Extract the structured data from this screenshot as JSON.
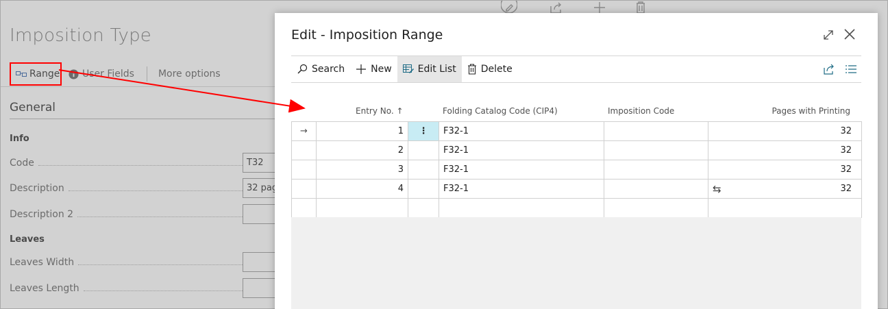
{
  "background": {
    "title": "Imposition Type",
    "actions": {
      "range": "Range",
      "user_fields": "User Fields",
      "more_options": "More options"
    },
    "section_general": "General",
    "group_info": "Info",
    "group_leaves": "Leaves",
    "fields": {
      "code": {
        "label": "Code",
        "value": "T32"
      },
      "description": {
        "label": "Description",
        "value": "32 pag"
      },
      "description2": {
        "label": "Description 2",
        "value": ""
      },
      "leaves_width": {
        "label": "Leaves Width",
        "value": ""
      },
      "leaves_length": {
        "label": "Leaves Length",
        "value": ""
      }
    }
  },
  "dialog": {
    "title": "Edit - Imposition Range",
    "toolbar": {
      "search": "Search",
      "new": "New",
      "edit_list": "Edit List",
      "delete": "Delete"
    },
    "columns": {
      "entry_no": "Entry No. ↑",
      "folding_catalog": "Folding Catalog Code (CIP4)",
      "imposition_code": "Imposition Code",
      "pages_printing": "Pages with Printing"
    },
    "rows": [
      {
        "entry": "1",
        "folding": "F32-1",
        "imposition": "",
        "pages": "32"
      },
      {
        "entry": "2",
        "folding": "F32-1",
        "imposition": "",
        "pages": "32"
      },
      {
        "entry": "3",
        "folding": "F32-1",
        "imposition": "",
        "pages": "32"
      },
      {
        "entry": "4",
        "folding": "F32-1",
        "imposition": "",
        "pages": "32"
      }
    ],
    "row_indicator": "→",
    "swap_icon_glyph": "⇆",
    "menu_glyph": "⋮"
  },
  "colors": {
    "highlight_red": "#ff0000",
    "selected_cell": "#c8ecf4"
  }
}
